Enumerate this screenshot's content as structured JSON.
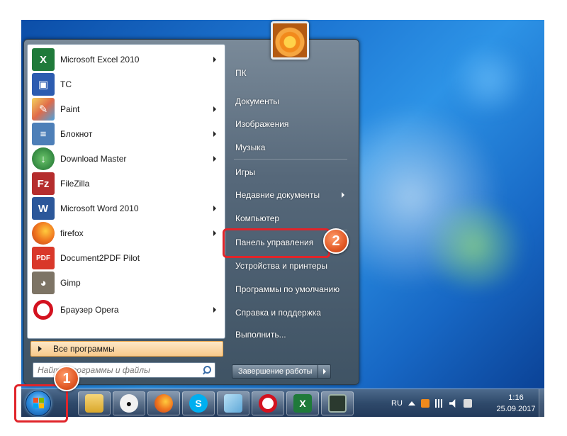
{
  "start_menu": {
    "programs": [
      {
        "label": "Microsoft Excel 2010",
        "icon": "excel-icon",
        "arrow": true
      },
      {
        "label": "TC",
        "icon": "floppy-icon",
        "arrow": false
      },
      {
        "label": "Paint",
        "icon": "paint-icon",
        "arrow": true
      },
      {
        "label": "Блокнот",
        "icon": "notepad-icon",
        "arrow": true
      },
      {
        "label": "Download Master",
        "icon": "download-master-icon",
        "arrow": true
      },
      {
        "label": "FileZilla",
        "icon": "filezilla-icon",
        "arrow": false
      },
      {
        "label": "Microsoft Word 2010",
        "icon": "word-icon",
        "arrow": true
      },
      {
        "label": "firefox",
        "icon": "firefox-icon",
        "arrow": true
      },
      {
        "label": "Document2PDF Pilot",
        "icon": "pdf-icon",
        "arrow": false
      },
      {
        "label": "Gimp",
        "icon": "gimp-icon",
        "arrow": false
      },
      {
        "label": "Браузер Opera",
        "icon": "opera-icon",
        "arrow": true
      }
    ],
    "all_programs": "Все программы",
    "search_placeholder": "Найти программы и файлы",
    "right_items": [
      {
        "label": "ПК",
        "arrow": false
      },
      {
        "label": "Документы",
        "arrow": false
      },
      {
        "label": "Изображения",
        "arrow": false
      },
      {
        "label": "Музыка",
        "arrow": false
      },
      {
        "label": "Игры",
        "arrow": false
      },
      {
        "label": "Недавние документы",
        "arrow": true
      },
      {
        "label": "Компьютер",
        "arrow": false
      },
      {
        "label": "Панель управления",
        "arrow": false
      },
      {
        "label": "Устройства и принтеры",
        "arrow": false
      },
      {
        "label": "Программы по умолчанию",
        "arrow": false
      },
      {
        "label": "Справка и поддержка",
        "arrow": false
      },
      {
        "label": "Выполнить...",
        "arrow": false
      }
    ],
    "shutdown": "Завершение работы"
  },
  "annotations": {
    "badge1": "1",
    "badge2": "2"
  },
  "taskbar": {
    "pinned": [
      "explorer-icon",
      "panda-icon",
      "firefox-icon",
      "skype-icon",
      "notepad-icon",
      "opera-icon",
      "excel-icon",
      "monitor-icon"
    ],
    "tray_lang": "RU",
    "time": "1:16",
    "date": "25.09.2017"
  }
}
